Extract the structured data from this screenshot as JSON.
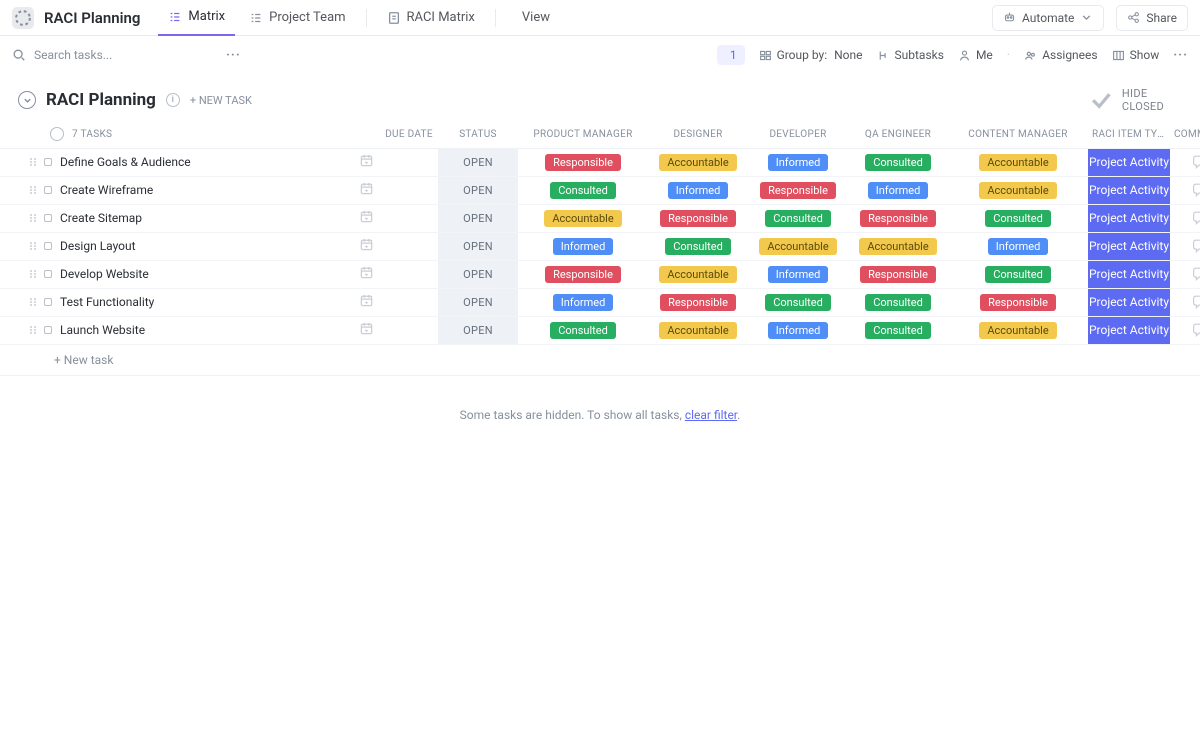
{
  "topbar": {
    "workspace": "RACI Planning",
    "tabs": [
      {
        "label": "Matrix",
        "icon": "list"
      },
      {
        "label": "Project Team",
        "icon": "list"
      },
      {
        "label": "RACI Matrix",
        "icon": "doc"
      }
    ],
    "view_btn": "View",
    "automate": "Automate",
    "share": "Share"
  },
  "toolbar": {
    "search_ph": "Search tasks...",
    "filter_count": "1",
    "groupby_label": "Group by:",
    "groupby_value": "None",
    "subtasks": "Subtasks",
    "me": "Me",
    "assignees": "Assignees",
    "show": "Show"
  },
  "group": {
    "title": "RACI Planning",
    "newtask": "+ NEW TASK",
    "hideclosed": "HIDE CLOSED",
    "count_label": "7 TASKS"
  },
  "columns": {
    "due": "DUE DATE",
    "status": "STATUS",
    "pm": "PRODUCT MANAGER",
    "des": "DESIGNER",
    "dev": "DEVELOPER",
    "qa": "QA ENGINEER",
    "cm": "CONTENT MANAGER",
    "raci": "RACI ITEM TYPE",
    "cmt": "COMMENTS"
  },
  "status_open": "OPEN",
  "raci_label": "Project Activity",
  "badges": {
    "Responsible": "b-resp",
    "Accountable": "b-acc",
    "Informed": "b-inf",
    "Consulted": "b-cons"
  },
  "tasks": [
    {
      "name": "Define Goals & Audience",
      "pm": "Responsible",
      "des": "Accountable",
      "dev": "Informed",
      "qa": "Consulted",
      "cm": "Accountable"
    },
    {
      "name": "Create Wireframe",
      "pm": "Consulted",
      "des": "Informed",
      "dev": "Responsible",
      "qa": "Informed",
      "cm": "Accountable"
    },
    {
      "name": "Create Sitemap",
      "pm": "Accountable",
      "des": "Responsible",
      "dev": "Consulted",
      "qa": "Responsible",
      "cm": "Consulted"
    },
    {
      "name": "Design Layout",
      "pm": "Informed",
      "des": "Consulted",
      "dev": "Accountable",
      "qa": "Accountable",
      "cm": "Informed"
    },
    {
      "name": "Develop Website",
      "pm": "Responsible",
      "des": "Accountable",
      "dev": "Informed",
      "qa": "Responsible",
      "cm": "Consulted"
    },
    {
      "name": "Test Functionality",
      "pm": "Informed",
      "des": "Responsible",
      "dev": "Consulted",
      "qa": "Consulted",
      "cm": "Responsible"
    },
    {
      "name": "Launch Website",
      "pm": "Consulted",
      "des": "Accountable",
      "dev": "Informed",
      "qa": "Consulted",
      "cm": "Accountable"
    }
  ],
  "addrow": "+ New task",
  "hiddenmsg": {
    "pre": "Some tasks are hidden. To show all tasks, ",
    "link": "clear filter",
    "post": "."
  }
}
